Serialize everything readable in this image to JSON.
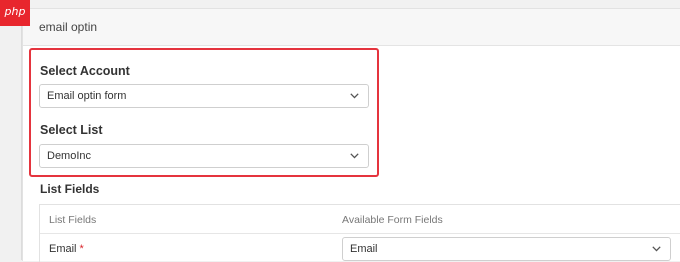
{
  "watermark": {
    "text": "php"
  },
  "panel": {
    "title": "email optin"
  },
  "account": {
    "label": "Select Account",
    "selected": "Email optin form"
  },
  "list": {
    "label": "Select List",
    "selected": "DemoInc"
  },
  "list_fields": {
    "heading": "List Fields",
    "columns": [
      "List Fields",
      "Available Form Fields"
    ],
    "rows": [
      {
        "field": "Email",
        "required_mark": "*",
        "mapped": "Email"
      }
    ]
  },
  "colors": {
    "highlight": "#e5343e",
    "required": "#d9262c"
  },
  "icons": {
    "dropdown": "chevron-down-icon"
  }
}
